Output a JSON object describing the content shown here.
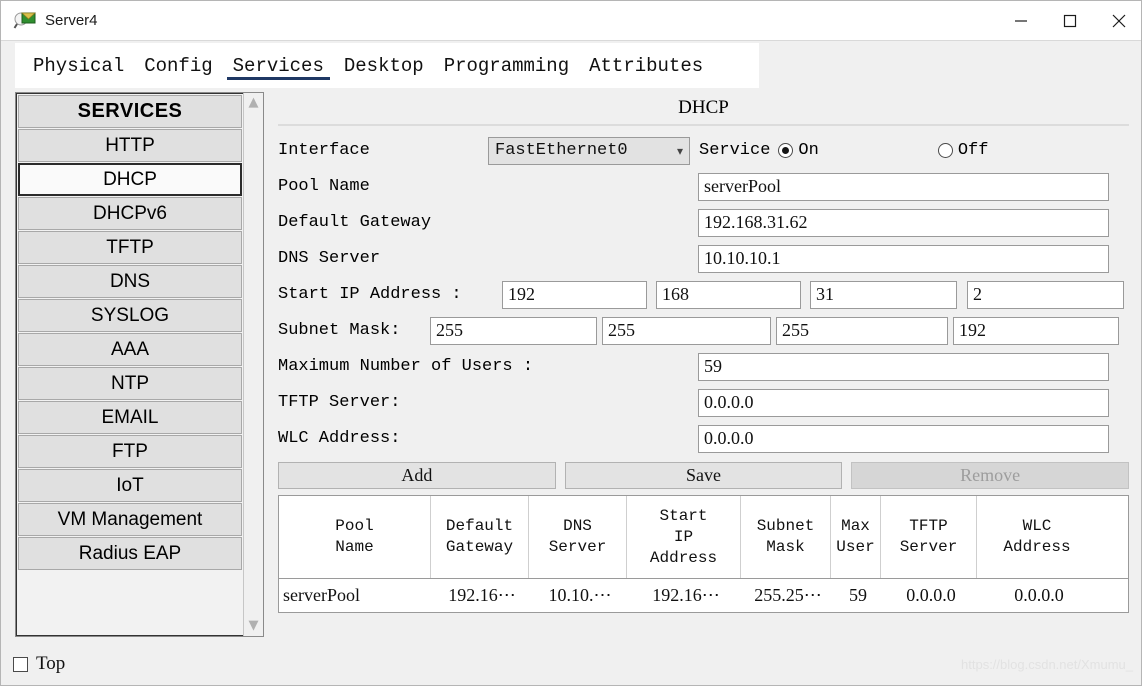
{
  "window": {
    "title": "Server4",
    "icon": "server-magnifier-icon",
    "minimize_label": "—",
    "maximize_label": "□",
    "close_label": "✕"
  },
  "tabs": [
    {
      "label": "Physical",
      "active": false
    },
    {
      "label": "Config",
      "active": false
    },
    {
      "label": "Services",
      "active": true
    },
    {
      "label": "Desktop",
      "active": false
    },
    {
      "label": "Programming",
      "active": false
    },
    {
      "label": "Attributes",
      "active": false
    }
  ],
  "sidebar": {
    "header": "SERVICES",
    "items": [
      {
        "label": "HTTP",
        "selected": false
      },
      {
        "label": "DHCP",
        "selected": true
      },
      {
        "label": "DHCPv6",
        "selected": false
      },
      {
        "label": "TFTP",
        "selected": false
      },
      {
        "label": "DNS",
        "selected": false
      },
      {
        "label": "SYSLOG",
        "selected": false
      },
      {
        "label": "AAA",
        "selected": false
      },
      {
        "label": "NTP",
        "selected": false
      },
      {
        "label": "EMAIL",
        "selected": false
      },
      {
        "label": "FTP",
        "selected": false
      },
      {
        "label": "IoT",
        "selected": false
      },
      {
        "label": "VM Management",
        "selected": false
      },
      {
        "label": "Radius EAP",
        "selected": false
      }
    ],
    "scroll_up_icon": "chevron-up-icon",
    "scroll_down_icon": "chevron-down-icon"
  },
  "panel": {
    "title": "DHCP",
    "interface": {
      "label": "Interface",
      "value": "FastEthernet0",
      "caret_icon": "chevron-down-icon"
    },
    "service": {
      "label": "Service",
      "on_label": "On",
      "off_label": "Off",
      "selected": "On"
    },
    "fields": {
      "pool_name": {
        "label": "Pool Name",
        "value": "serverPool"
      },
      "default_gateway": {
        "label": "Default Gateway",
        "value": "192.168.31.62"
      },
      "dns_server": {
        "label": "DNS Server",
        "value": "10.10.10.1"
      },
      "start_ip": {
        "label": "Start IP Address :",
        "octets": [
          "192",
          "168",
          "31",
          "2"
        ]
      },
      "subnet_mask": {
        "label": "Subnet Mask:",
        "octets": [
          "255",
          "255",
          "255",
          "192"
        ]
      },
      "max_users": {
        "label": "Maximum Number of Users :",
        "value": "59"
      },
      "tftp_server": {
        "label": "TFTP Server:",
        "value": "0.0.0.0"
      },
      "wlc_address": {
        "label": "WLC Address:",
        "value": "0.0.0.0"
      }
    },
    "buttons": {
      "add": "Add",
      "save": "Save",
      "remove": "Remove",
      "remove_disabled": true
    },
    "table": {
      "headers": [
        "Pool Name",
        "Default Gateway",
        "DNS Server",
        "Start IP Address",
        "Subnet Mask",
        "Max User",
        "TFTP Server",
        "WLC Address"
      ],
      "rows": [
        [
          "serverPool",
          "192.16⋯",
          "10.10.⋯",
          "192.16⋯",
          "255.25⋯",
          "59",
          "0.0.0.0",
          "0.0.0.0"
        ]
      ]
    }
  },
  "bottom": {
    "top_checkbox_label": "Top",
    "top_checked": false,
    "watermark": "https://blog.csdn.net/Xmumu_"
  }
}
